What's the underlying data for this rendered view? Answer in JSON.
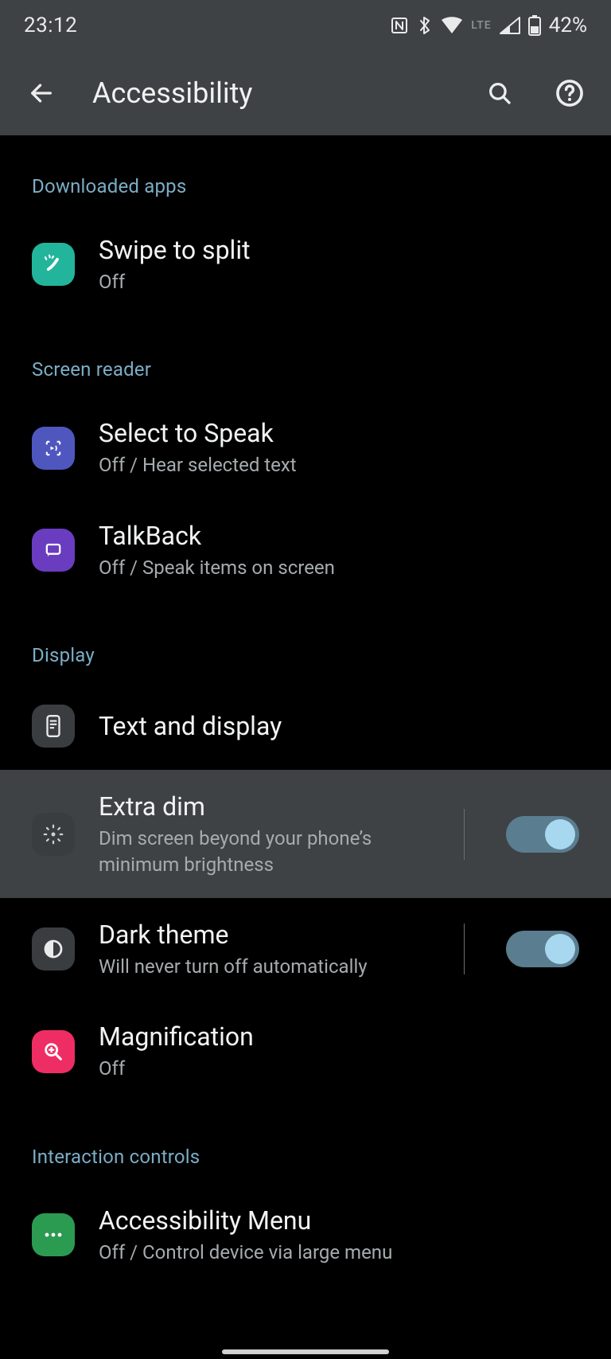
{
  "status": {
    "time": "23:12",
    "battery": "42%"
  },
  "appbar": {
    "title": "Accessibility"
  },
  "sections": {
    "downloaded": {
      "header": "Downloaded apps",
      "swipe": {
        "title": "Swipe to split",
        "sub": "Off"
      }
    },
    "reader": {
      "header": "Screen reader",
      "select": {
        "title": "Select to Speak",
        "sub": "Off / Hear selected text"
      },
      "talkback": {
        "title": "TalkBack",
        "sub": "Off / Speak items on screen"
      }
    },
    "display": {
      "header": "Display",
      "text": {
        "title": "Text and display"
      },
      "extradim": {
        "title": "Extra dim",
        "sub": "Dim screen beyond your phone’s minimum brightness",
        "on": true
      },
      "dark": {
        "title": "Dark theme",
        "sub": "Will never turn off automatically",
        "on": true
      },
      "mag": {
        "title": "Magnification",
        "sub": "Off"
      }
    },
    "interaction": {
      "header": "Interaction controls",
      "menu": {
        "title": "Accessibility Menu",
        "sub": "Off / Control device via large menu"
      }
    }
  }
}
